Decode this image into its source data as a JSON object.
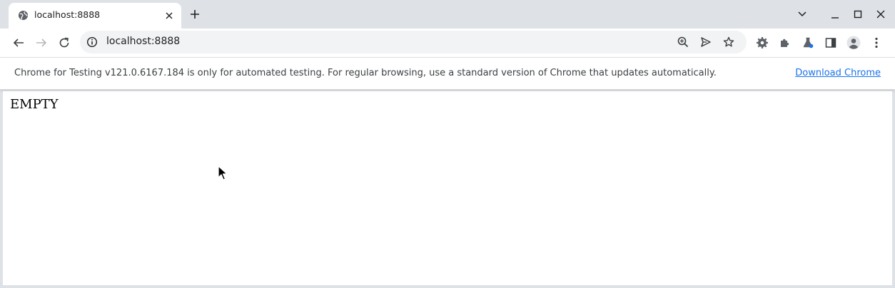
{
  "tab": {
    "title": "localhost:8888",
    "favicon": "globe-icon"
  },
  "toolbar": {
    "url": "localhost:8888",
    "icons": [
      "back-arrow-icon",
      "forward-arrow-icon",
      "reload-icon",
      "site-info-icon",
      "zoom-icon",
      "send-icon",
      "bookmark-star-icon",
      "extension-gear-icon",
      "extensions-puzzle-icon",
      "lab-flask-icon",
      "side-panel-icon",
      "profile-avatar-icon",
      "kebab-menu-icon"
    ]
  },
  "infobar": {
    "message": "Chrome for Testing v121.0.6167.184 is only for automated testing. For regular browsing, use a standard version of Chrome that updates automatically.",
    "link": "Download Chrome"
  },
  "page": {
    "body_text": "EMPTY"
  },
  "colors": {
    "frame": "#dee1e6",
    "omnibox": "#f1f3f4",
    "link": "#1a73e8",
    "icon": "#5f6368"
  }
}
